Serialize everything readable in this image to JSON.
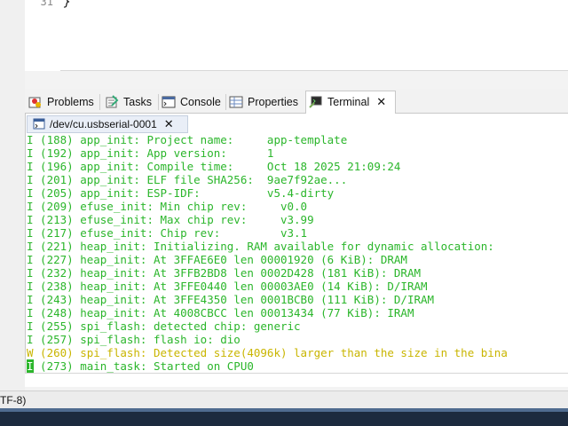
{
  "editor": {
    "line_number": "31",
    "line_text": "}"
  },
  "views": {
    "tabs": [
      {
        "label": "Problems",
        "icon": "problems-icon"
      },
      {
        "label": "Tasks",
        "icon": "tasks-icon"
      },
      {
        "label": "Console",
        "icon": "console-icon"
      },
      {
        "label": "Properties",
        "icon": "properties-icon"
      },
      {
        "label": "Terminal",
        "icon": "terminal-icon",
        "active": true
      }
    ],
    "close_glyph": "✕"
  },
  "terminal": {
    "session_tab": "/dev/cu.usbserial-0001",
    "close_glyph": "✕",
    "lines": [
      {
        "text": "I (188) app_init: Project name:     app-template",
        "level": "info"
      },
      {
        "text": "I (192) app_init: App version:      1",
        "level": "info"
      },
      {
        "text": "I (196) app_init: Compile time:     Oct 18 2025 21:09:24",
        "level": "info"
      },
      {
        "text": "I (201) app_init: ELF file SHA256:  9ae7f92ae...",
        "level": "info"
      },
      {
        "text": "I (205) app_init: ESP-IDF:          v5.4-dirty",
        "level": "info"
      },
      {
        "text": "I (209) efuse_init: Min chip rev:     v0.0",
        "level": "info"
      },
      {
        "text": "I (213) efuse_init: Max chip rev:     v3.99",
        "level": "info"
      },
      {
        "text": "I (217) efuse_init: Chip rev:         v3.1",
        "level": "info"
      },
      {
        "text": "I (221) heap_init: Initializing. RAM available for dynamic allocation:",
        "level": "info"
      },
      {
        "text": "I (227) heap_init: At 3FFAE6E0 len 00001920 (6 KiB): DRAM",
        "level": "info"
      },
      {
        "text": "I (232) heap_init: At 3FFB2BD8 len 0002D428 (181 KiB): DRAM",
        "level": "info"
      },
      {
        "text": "I (238) heap_init: At 3FFE0440 len 00003AE0 (14 KiB): D/IRAM",
        "level": "info"
      },
      {
        "text": "I (243) heap_init: At 3FFE4350 len 0001BCB0 (111 KiB): D/IRAM",
        "level": "info"
      },
      {
        "text": "I (248) heap_init: At 4008CBCC len 00013434 (77 KiB): IRAM",
        "level": "info"
      },
      {
        "text": "I (255) spi_flash: detected chip: generic",
        "level": "info"
      },
      {
        "text": "I (257) spi_flash: flash io: dio",
        "level": "info"
      },
      {
        "text": "W (260) spi_flash: Detected size(4096k) larger than the size in the bina",
        "level": "warn"
      },
      {
        "text": " (273) main_task: Started on CPU0",
        "level": "info",
        "lead": "I"
      }
    ]
  },
  "status": {
    "encoding_fragment": "TF-8)"
  },
  "colors": {
    "info_text": "#2bb62b",
    "warn_text": "#c9b500"
  }
}
